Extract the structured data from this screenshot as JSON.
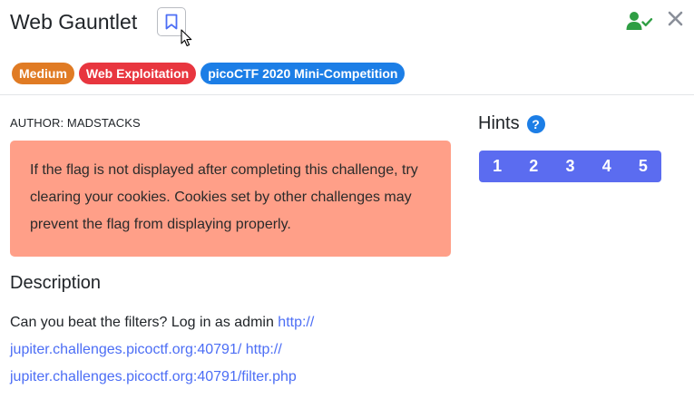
{
  "header": {
    "title": "Web Gauntlet",
    "icons": {
      "bookmark": "bookmark-icon",
      "solved": "user-check-icon",
      "close": "close-icon"
    }
  },
  "tags": [
    {
      "label": "Medium",
      "color": "#e07b24"
    },
    {
      "label": "Web Exploitation",
      "color": "#e8363f"
    },
    {
      "label": "picoCTF 2020 Mini-Competition",
      "color": "#1c7ee6"
    }
  ],
  "author": "AUTHOR: MADSTACKS",
  "alert": {
    "text": "If the flag is not displayed after completing this challenge, try clearing your cookies. Cookies set by other challenges may prevent the flag from displaying properly."
  },
  "description": {
    "heading": "Description",
    "text": "Can you beat the filters? Log in as admin",
    "links": [
      "http:// jupiter.challenges.picoctf.org:40791/",
      "http:// jupiter.challenges.picoctf.org:40791/filter.php"
    ]
  },
  "hints": {
    "heading": "Hints",
    "help_glyph": "?",
    "buttons": [
      "1",
      "2",
      "3",
      "4",
      "5"
    ]
  },
  "colors": {
    "accent": "#4c6ef5",
    "alert_bg": "#ff9f88",
    "hint_bg": "#5b6cf0",
    "solved": "#2f9e44"
  }
}
